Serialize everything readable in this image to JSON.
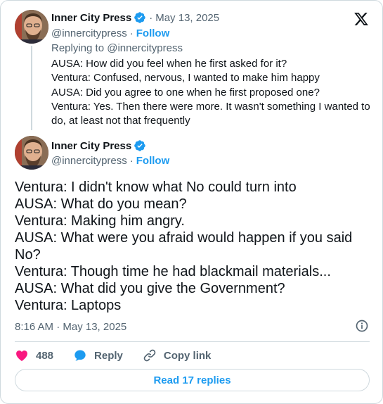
{
  "colors": {
    "accent": "#1d9bf0",
    "muted": "#536471",
    "heart": "#f91880",
    "border": "#cfd9de"
  },
  "parent_tweet": {
    "author_name": "Inner City Press",
    "date": "May 13, 2025",
    "handle": "@innercitypress",
    "follow_label": "Follow",
    "replying_to": "Replying to @innercitypress",
    "lines": [
      "AUSA: How did you feel when he first asked for it?",
      "Ventura: Confused, nervous, I wanted to make him happy",
      "AUSA: Did you agree to one when he first proposed one?",
      "Ventura: Yes. Then there were more. It wasn't something I wanted to do, at least not that frequently"
    ]
  },
  "main_tweet": {
    "author_name": "Inner City Press",
    "handle": "@innercitypress",
    "follow_label": "Follow",
    "lines": [
      "Ventura: I didn't know what No could turn into",
      "AUSA: What do you mean?",
      "Ventura: Making him angry.",
      "AUSA: What were you afraid would happen if you said No?",
      "Ventura: Though time he had blackmail materials...",
      "AUSA: What did you give the Government?",
      "Ventura: Laptops"
    ],
    "timestamp": "8:16 AM · May 13, 2025"
  },
  "actions": {
    "like_count": "488",
    "reply_label": "Reply",
    "copy_link_label": "Copy link"
  },
  "read_replies_label": "Read 17 replies",
  "icons": [
    "x-logo-icon",
    "verified-badge-icon",
    "info-icon",
    "heart-icon",
    "reply-bubble-icon",
    "link-icon"
  ]
}
